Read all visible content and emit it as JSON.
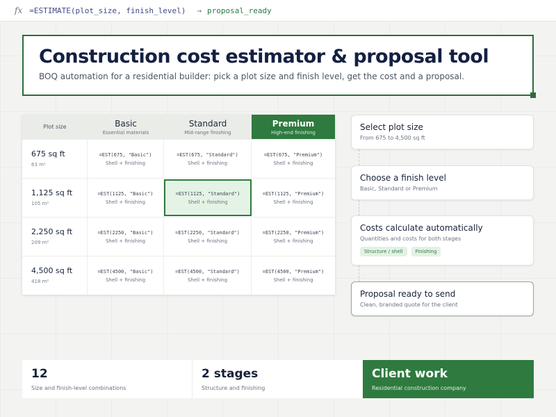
{
  "formula": {
    "fx": "fx",
    "func": "=ESTIMATE(",
    "arg1": "plot_size",
    "sep": ", ",
    "arg2": "finish_level",
    "close": ")",
    "arrow": "→",
    "result": "proposal_ready"
  },
  "header": {
    "title": "Construction cost estimator & proposal tool",
    "subtitle": "BOQ automation for a residential builder: pick a plot size and finish level, get the cost and a proposal."
  },
  "table": {
    "corner_label": "Plot size",
    "columns": [
      {
        "title": "Basic",
        "sub": "Essential materials"
      },
      {
        "title": "Standard",
        "sub": "Mid-range finishing"
      },
      {
        "title": "Premium",
        "sub": "High-end finishing"
      }
    ],
    "cell_sub": "Shell + finishing",
    "rows": [
      {
        "title": "675 sq ft",
        "sub": "63 m²",
        "cells": [
          "=EST(675, \"Basic\")",
          "=EST(675, \"Standard\")",
          "=EST(675, \"Premium\")"
        ]
      },
      {
        "title": "1,125 sq ft",
        "sub": "105 m²",
        "cells": [
          "=EST(1125, \"Basic\")",
          "=EST(1125, \"Standard\")",
          "=EST(1125, \"Premium\")"
        ]
      },
      {
        "title": "2,250 sq ft",
        "sub": "209 m²",
        "cells": [
          "=EST(2250, \"Basic\")",
          "=EST(2250, \"Standard\")",
          "=EST(2250, \"Premium\")"
        ]
      },
      {
        "title": "4,500 sq ft",
        "sub": "418 m²",
        "cells": [
          "=EST(4500, \"Basic\")",
          "=EST(4500, \"Standard\")",
          "=EST(4500, \"Premium\")"
        ]
      }
    ]
  },
  "steps": [
    {
      "title": "Select plot size",
      "desc": "From 675 to 4,500 sq ft"
    },
    {
      "title": "Choose a finish level",
      "desc": "Basic, Standard or Premium"
    },
    {
      "title": "Costs calculate automatically",
      "desc": "Quantities and costs for both stages",
      "chips": [
        "Structure / shell",
        "Finishing"
      ]
    },
    {
      "title": "Proposal ready to send",
      "desc": "Clean, branded quote for the client"
    }
  ],
  "stats": [
    {
      "value": "12",
      "label": "Size and finish-level combinations"
    },
    {
      "value": "2 stages",
      "label": "Structure and finishing"
    },
    {
      "value": "Client work",
      "label": "Residential construction company"
    }
  ],
  "colors": {
    "accent": "#2e7a3f",
    "title": "#142042",
    "background": "#f3f4f2"
  }
}
